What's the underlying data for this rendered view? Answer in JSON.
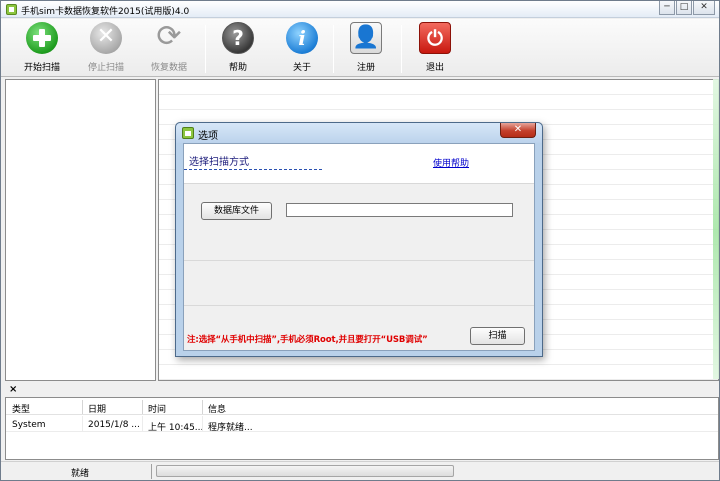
{
  "window": {
    "title": "手机sim卡数据恢复软件2015(试用版)4.0",
    "controls": {
      "minimize": "─",
      "maximize": "□",
      "close": "✕"
    }
  },
  "toolbar": {
    "start_scan": "开始扫描",
    "stop_scan": "停止扫描",
    "restore_data": "恢复数据",
    "help": "帮助",
    "about": "关于",
    "register": "注册",
    "exit": "退出",
    "icons": {
      "stop_glyph": "✕",
      "restore_glyph": "⟳",
      "help_glyph": "?",
      "about_glyph": "i",
      "register_glyph": "👤",
      "exit_glyph": "⏻"
    }
  },
  "dialog": {
    "title": "选项",
    "close_glyph": "✕",
    "section_title": "选择扫描方式",
    "help_link": "使用帮助",
    "db_file_button": "数据库文件",
    "db_file_value": "",
    "note": "注:选择“从手机中扫描”,手机必须Root,并且要打开“USB调试”",
    "scan_button": "扫描"
  },
  "log": {
    "close_glyph": "×",
    "columns": [
      "类型",
      "日期",
      "时间",
      "信息"
    ],
    "rows": [
      {
        "type": "System",
        "date": "2015/1/8 ...",
        "time": "上午 10:45...",
        "info": "程序就绪..."
      }
    ]
  },
  "statusbar": {
    "status": "就绪",
    "progress": 0
  },
  "colors": {
    "note_red": "#e00000",
    "link_blue": "#0000cc",
    "dialog_frame": "#b9d1ea",
    "exit_red": "#c8180f",
    "start_green": "#1f9d1f",
    "about_blue": "#1e7fd6"
  }
}
